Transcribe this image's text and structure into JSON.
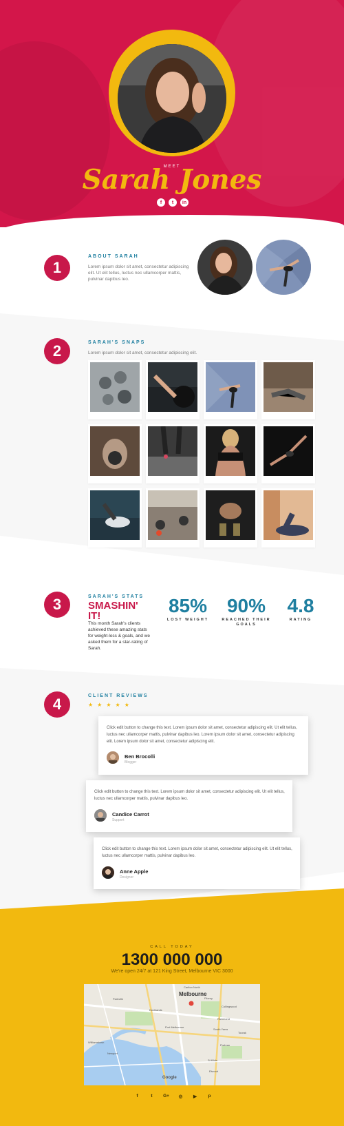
{
  "hero": {
    "meet": "MEET",
    "name": "Sarah Jones",
    "social": [
      {
        "icon": "facebook-icon",
        "glyph": "f"
      },
      {
        "icon": "twitter-icon",
        "glyph": "t"
      },
      {
        "icon": "linkedin-icon",
        "glyph": "in"
      }
    ]
  },
  "about": {
    "number": "1",
    "title": "ABOUT SARAH",
    "text": "Lorem ipsum dolor sit amet, consectetur adipiscing elit. Ut elit tellus, luctus nec ullamcorper mattis, pulvinar dapibus leo."
  },
  "snaps": {
    "number": "2",
    "title": "SARAH'S SNAPS",
    "text": "Lorem ipsum dolor sit amet, consectetur adipiscing elit."
  },
  "stats": {
    "number": "3",
    "title": "SARAH'S STATS",
    "headline": "SMASHIN' IT!",
    "text": "This month Sarah's clients achieved these amazing stats for weight-loss & goals, and we asked them for a star-rating of Sarah.",
    "items": [
      {
        "value": "85%",
        "label": "LOST WEIGHT"
      },
      {
        "value": "90%",
        "label": "REACHED THEIR GOALS"
      },
      {
        "value": "4.8",
        "label": "RATING"
      }
    ]
  },
  "reviews": {
    "number": "4",
    "title": "CLIENT REVIEWS",
    "stars": "★★★★★",
    "items": [
      {
        "text": "Click edit button to change this text. Lorem ipsum dolor sit amet, consectetur adipiscing elit. Ut elit tellus, luctus nec ullamcorper mattis, pulvinar dapibus leo. Lorem ipsum dolor sit amet, consectetur adipiscing elit. Lorem ipsum dolor sit amet, consectetur adipiscing elit.",
        "name": "Ben Brocolli",
        "role": "Blogger"
      },
      {
        "text": "Click edit button to change this text. Lorem ipsum dolor sit amet, consectetur adipiscing elit. Ut elit tellus, luctus nec ullamcorper mattis, pulvinar dapibus leo.",
        "name": "Candice Carrot",
        "role": "Support"
      },
      {
        "text": "Click edit button to change this text. Lorem ipsum dolor sit amet, consectetur adipiscing elit. Ut elit tellus, luctus nec ullamcorper mattis, pulvinar dapibus leo.",
        "name": "Anne Apple",
        "role": "Designer"
      }
    ]
  },
  "contact": {
    "call": "CALL TODAY",
    "phone": "1300 000 000",
    "hours": "We're open 24/7 at 121 King Street, Melbourne VIC 3000",
    "map": {
      "city": "Melbourne",
      "labels": [
        "Carlton North",
        "Parkville",
        "Collingwood",
        "Richmond",
        "South Yarra",
        "Toorak",
        "Williamstown",
        "Newport",
        "St Kilda",
        "Elwood",
        "Port Melbourne",
        "Prahran",
        "Docklands",
        "Fitzroy"
      ],
      "provider": "Google"
    },
    "social": [
      {
        "icon": "facebook-icon",
        "glyph": "f"
      },
      {
        "icon": "twitter-icon",
        "glyph": "t"
      },
      {
        "icon": "google-plus-icon",
        "glyph": "G+"
      },
      {
        "icon": "instagram-icon",
        "glyph": "◎"
      },
      {
        "icon": "youtube-icon",
        "glyph": "▶"
      },
      {
        "icon": "pinterest-icon",
        "glyph": "p"
      }
    ]
  },
  "colors": {
    "primary": "#d3164a",
    "accent": "#f2b90f",
    "blue": "#1f7fa0"
  }
}
